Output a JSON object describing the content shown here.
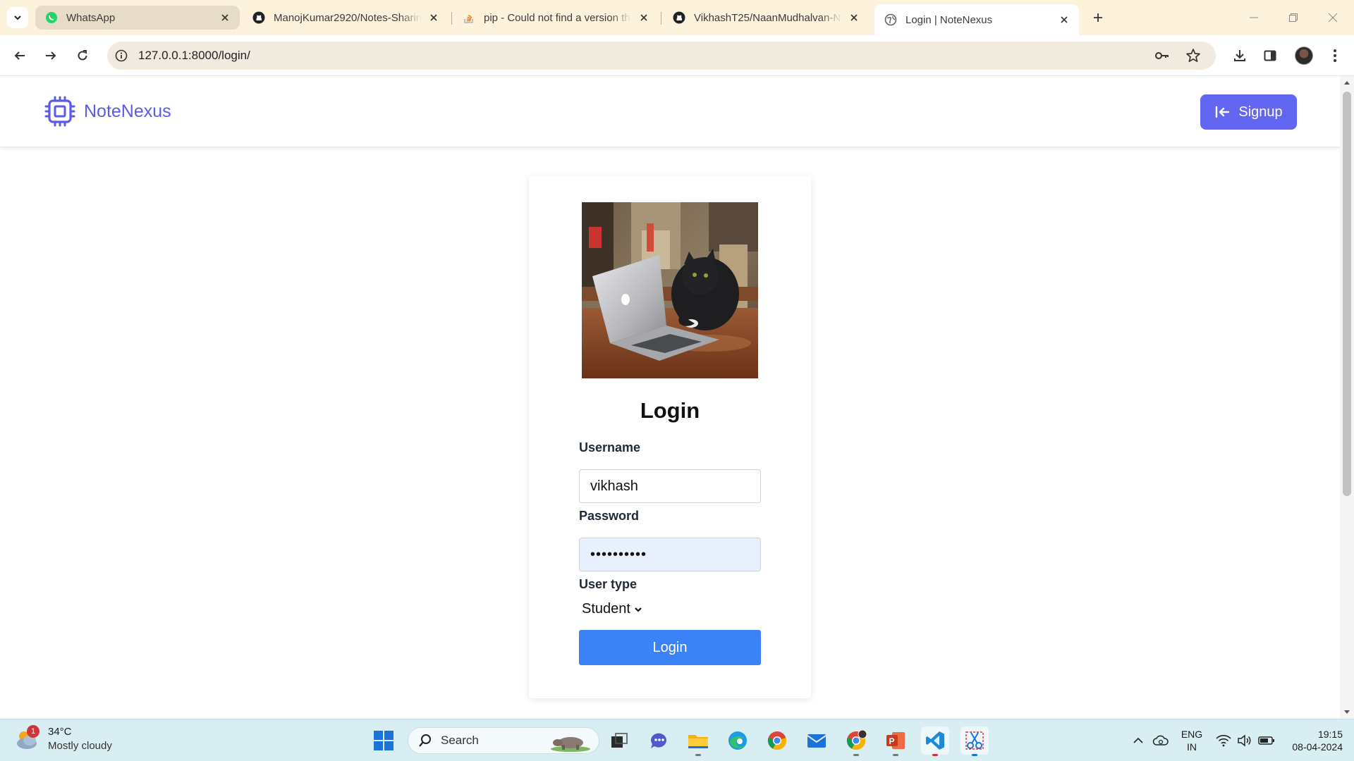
{
  "browser": {
    "tabs": [
      {
        "title": "WhatsApp",
        "icon": "whatsapp-icon",
        "state": "hover"
      },
      {
        "title": "ManojKumar2920/Notes-Sharing",
        "icon": "github-icon",
        "state": "normal"
      },
      {
        "title": "pip - Could not find a version that",
        "icon": "stackoverflow-icon",
        "state": "normal"
      },
      {
        "title": "VikhashT25/NaanMudhalvan-N",
        "icon": "github-icon",
        "state": "normal"
      },
      {
        "title": "Login | NoteNexus",
        "icon": "globe-icon",
        "state": "active"
      }
    ],
    "url": "127.0.0.1:8000/login/"
  },
  "page": {
    "brand": {
      "name": "NoteNexus",
      "accent": "#5b5be8"
    },
    "signup_label": "Signup",
    "form": {
      "title": "Login",
      "username_label": "Username",
      "username_value": "vikhash",
      "password_label": "Password",
      "password_value": "••••••••••",
      "usertype_label": "User type",
      "usertype_value": "Student",
      "submit_label": "Login"
    },
    "colors": {
      "signup_button": "#6366f1",
      "login_button": "#3b82f6",
      "autofill": "#e8f0fe"
    }
  },
  "taskbar": {
    "weather": {
      "temp": "34°C",
      "desc": "Mostly cloudy",
      "badge": "1"
    },
    "search_label": "Search",
    "lang": {
      "line1": "ENG",
      "line2": "IN"
    },
    "clock": {
      "time": "19:15",
      "date": "08-04-2024"
    }
  }
}
